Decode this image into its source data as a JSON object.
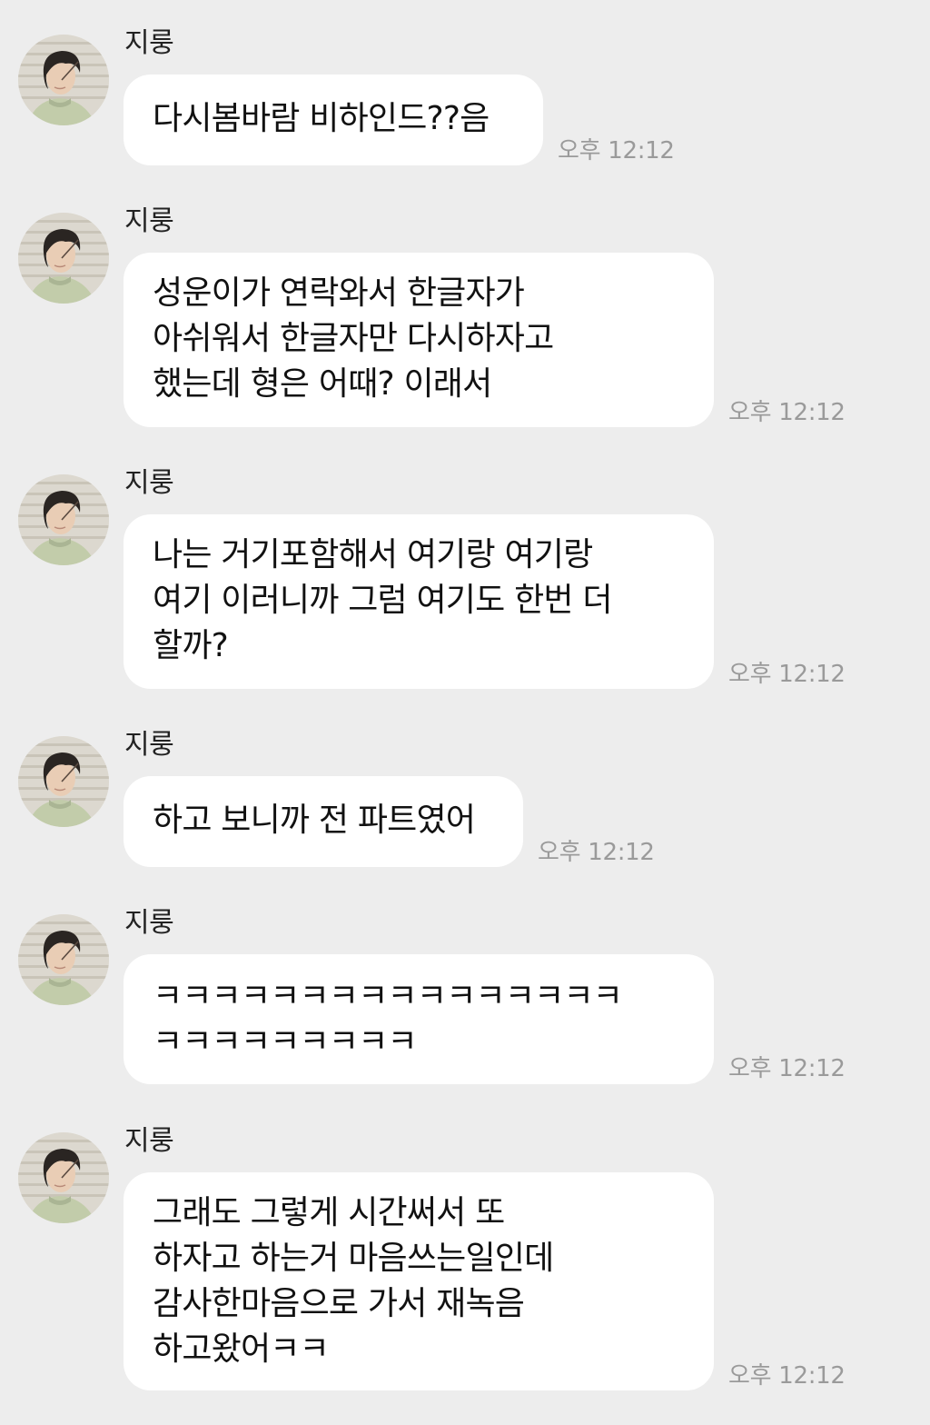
{
  "chat": {
    "messages": [
      {
        "sender": "지룽",
        "avatar": "profile-photo",
        "lines": [
          "다시봄바람 비하인드??음"
        ],
        "time": "오후 12:12"
      },
      {
        "sender": "지룽",
        "avatar": "profile-photo",
        "lines": [
          "성운이가 연락와서 한글자가",
          "아쉬워서 한글자만 다시하자고",
          "했는데 형은 어때? 이래서"
        ],
        "time": "오후 12:12"
      },
      {
        "sender": "지룽",
        "avatar": "profile-photo",
        "lines": [
          "나는 거기포함해서 여기랑 여기랑",
          "여기 이러니까 그럼 여기도 한번 더",
          "할까?"
        ],
        "time": "오후 12:12"
      },
      {
        "sender": "지룽",
        "avatar": "profile-photo",
        "lines": [
          "하고 보니까 전 파트였어"
        ],
        "time": "오후 12:12"
      },
      {
        "sender": "지룽",
        "avatar": "profile-photo",
        "lines": [
          "ㅋㅋㅋㅋㅋㅋㅋㅋㅋㅋㅋㅋㅋㅋㅋㅋ",
          "ㅋㅋㅋㅋㅋㅋㅋㅋㅋ"
        ],
        "time": "오후 12:12"
      },
      {
        "sender": "지룽",
        "avatar": "profile-photo",
        "lines": [
          "그래도 그렇게 시간써서 또",
          "하자고 하는거 마음쓰는일인데",
          "감사한마음으로 가서 재녹음",
          "하고왔어ㅋㅋ"
        ],
        "time": "오후 12:12"
      }
    ]
  },
  "colors": {
    "background": "#ededed",
    "bubble": "#ffffff",
    "text": "#111111",
    "time": "#9a9a9a"
  }
}
